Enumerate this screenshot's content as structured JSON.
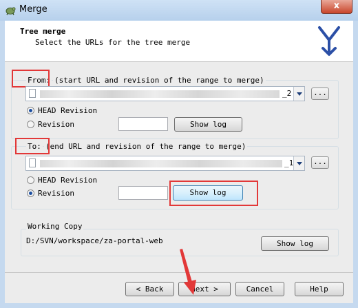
{
  "window": {
    "title": "Merge",
    "close_label": "x"
  },
  "header": {
    "title": "Tree merge",
    "subtitle": "Select the URLs for the tree merge"
  },
  "from": {
    "label": "From:",
    "description": "(start URL and revision of the range to merge)",
    "url_suffix": "_2",
    "browse_label": "...",
    "head_revision_label": "HEAD Revision",
    "revision_label": "Revision",
    "revision_value": "",
    "selected": "HEAD Revision",
    "show_log_label": "Show log"
  },
  "to": {
    "label": "To:",
    "description": "(end URL and revision of the range to merge)",
    "url_suffix": "_1",
    "browse_label": "...",
    "head_revision_label": "HEAD Revision",
    "revision_label": "Revision",
    "revision_value": "",
    "selected": "Revision",
    "show_log_label": "Show log"
  },
  "working_copy": {
    "label": "Working Copy",
    "path": "D:/SVN/workspace/za-portal-web",
    "show_log_label": "Show log"
  },
  "footer": {
    "back_label": "< Back",
    "next_label": "Next >",
    "cancel_label": "Cancel",
    "help_label": "Help"
  },
  "colors": {
    "annotation": "#e23838",
    "accent": "#1d4fa0",
    "frame": "#c5d9ef"
  }
}
